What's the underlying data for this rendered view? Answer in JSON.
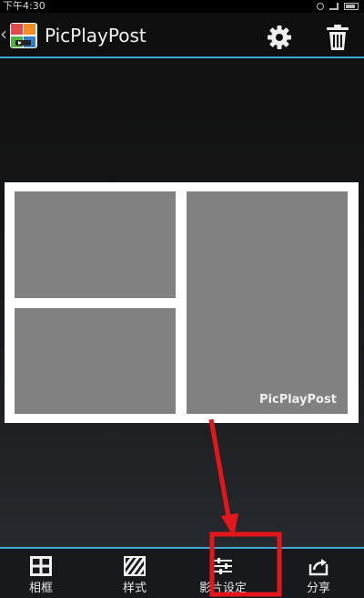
{
  "status_bar": {
    "time": "下午4:30"
  },
  "header": {
    "title": "PicPlayPost",
    "icons": {
      "back": "chevron-left-icon",
      "logo": "app-logo-icon",
      "settings": "gear-icon",
      "delete": "trash-icon"
    }
  },
  "collage": {
    "watermark": "PicPlayPost"
  },
  "toolbar": {
    "items": [
      {
        "label": "相框",
        "icon": "grid-frame-icon"
      },
      {
        "label": "样式",
        "icon": "striped-pattern-icon"
      },
      {
        "label": "影片设定",
        "icon": "sliders-icon"
      },
      {
        "label": "分享",
        "icon": "share-icon"
      }
    ]
  },
  "colors": {
    "accent": "#3fa9d6",
    "annotation": "#e3161b",
    "cell": "#818181"
  }
}
